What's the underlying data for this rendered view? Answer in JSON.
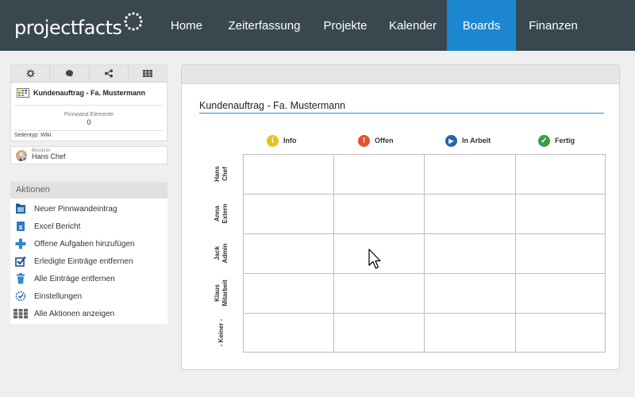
{
  "app": {
    "logo_text": "projectfacts"
  },
  "nav": {
    "items": [
      {
        "label": "Home"
      },
      {
        "label": "Zeiterfassung"
      },
      {
        "label": "Projekte"
      },
      {
        "label": "Kalender"
      },
      {
        "label": "Boards",
        "active": true
      },
      {
        "label": "Finanzen"
      }
    ]
  },
  "sidebar": {
    "toolbar_icons": [
      "settings-icon",
      "comment-icon",
      "share-icon",
      "grid-icon"
    ],
    "page_title": "Kundenauftrag - Fa. Mustermann",
    "pinboard_label": "Pinnwand Elemente",
    "pinboard_count": "0",
    "page_type": "Seitentyp: Wiki",
    "owner_label": "Besitzer",
    "owner_name": "Hans Chef"
  },
  "actions": {
    "heading": "Aktionen",
    "items": [
      {
        "label": "Neuer Pinnwandeintrag",
        "icon": "new-pin-icon"
      },
      {
        "label": "Excel Bericht",
        "icon": "excel-icon"
      },
      {
        "label": "Offene Aufgaben hinzufügen",
        "icon": "plus-icon"
      },
      {
        "label": "Erledigte Einträge entfernen",
        "icon": "checkbox-icon"
      },
      {
        "label": "Alle Einträge entfernen",
        "icon": "trash-icon"
      },
      {
        "label": "Einstellungen",
        "icon": "settings-check-icon"
      },
      {
        "label": "Alle Aktionen anzeigen",
        "icon": "grid-icon"
      }
    ]
  },
  "board": {
    "title": "Kundenauftrag - Fa. Mustermann",
    "columns": [
      {
        "label": "Info",
        "color": "#e8c21e",
        "symbol": "i"
      },
      {
        "label": "Offen",
        "color": "#e3522c",
        "symbol": "!"
      },
      {
        "label": "In Arbeit",
        "color": "#2566a8",
        "symbol": "▶"
      },
      {
        "label": "Fertig",
        "color": "#3a9c4a",
        "symbol": "✓"
      }
    ],
    "rows": [
      {
        "line1": "Hans",
        "line2": "Chef"
      },
      {
        "line1": "Anna",
        "line2": "Extern"
      },
      {
        "line1": "Jack",
        "line2": "Admin"
      },
      {
        "line1": "Klaus",
        "line2": "Mitarbeit"
      },
      {
        "line1": "- Keiner -",
        "line2": ""
      }
    ]
  },
  "colors": {
    "nav_bg": "#39474f",
    "nav_active": "#1c86d1",
    "accent_line": "#2a8ad3"
  }
}
